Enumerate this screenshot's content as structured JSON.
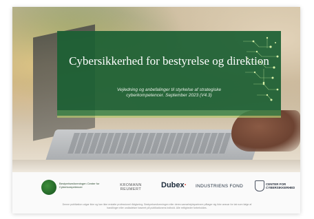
{
  "document": {
    "title": "Cybersikkerhed for bestyrelse og direktion",
    "subtitle": "Vejledning og anbefalinger til styrkelse af strategiske cyberkompetencer. September 2023 (V4.3)"
  },
  "logos": {
    "bestyrelsesforeningen": "Bestyrelsesforeningen Center for Cyberkompetencer",
    "kromann": "KROMANN REUMERT",
    "dubex": "Dubex",
    "dubex_dot": "·",
    "industriens": "INDUSTRIENS FOND",
    "cfcs": "CENTER FOR CYBERSIKKERHED"
  },
  "footer": {
    "text": "Denne publikation udgør ikke og kan ikke erstatte professionel rådgivning. Bestyrelsesforeningen eller deres samarbejdspartnere påtager sig ikke ansvar for tab som følge af handlinger eller undladelser baseret på publikationens indhold. Alle rettigheder forbeholdes."
  },
  "colors": {
    "banner": "#1c6034",
    "accent": "#b4c86e"
  }
}
